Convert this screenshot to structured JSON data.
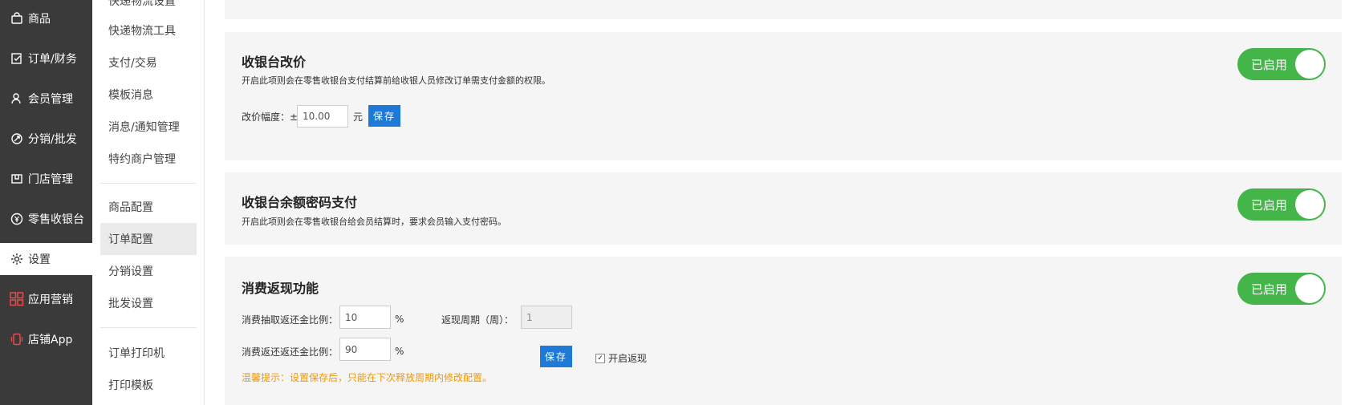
{
  "nav": {
    "items": [
      {
        "label": "商品",
        "icon": "shopping-bag-icon"
      },
      {
        "label": "订单/财务",
        "icon": "order-icon"
      },
      {
        "label": "会员管理",
        "icon": "members-icon"
      },
      {
        "label": "分销/批发",
        "icon": "distribution-icon"
      },
      {
        "label": "门店管理",
        "icon": "store-icon"
      },
      {
        "label": "零售收银台",
        "icon": "cashier-icon"
      },
      {
        "label": "设置",
        "icon": "gear-icon"
      },
      {
        "label": "应用营销",
        "icon": "apps-grid-icon"
      },
      {
        "label": "店铺App",
        "icon": "phone-icon"
      }
    ],
    "active_index": 6
  },
  "subnav": {
    "items": [
      {
        "label": "快递物流设置"
      },
      {
        "label": "快递物流工具"
      },
      {
        "label": "支付/交易"
      },
      {
        "label": "模板消息"
      },
      {
        "label": "消息/通知管理"
      },
      {
        "label": "特约商户管理"
      },
      {
        "label": "商品配置"
      },
      {
        "label": "订单配置"
      },
      {
        "label": "分销设置"
      },
      {
        "label": "批发设置"
      },
      {
        "label": "订单打印机"
      },
      {
        "label": "打印模板"
      }
    ],
    "active_label": "订单配置"
  },
  "panels": {
    "price_change": {
      "title": "收银台改价",
      "desc": "开启此项则会在零售收银台支付结算前给收银人员修改订单需支付金额的权限。",
      "toggle": "已启用",
      "range_label": "改价幅度：±",
      "range_value": "10.00",
      "unit": "元",
      "save": "保存"
    },
    "balance_password": {
      "title": "收银台余额密码支付",
      "desc": "开启此项则会在零售收银台给会员结算时，要求会员输入支付密码。",
      "toggle": "已启用"
    },
    "cashback": {
      "title": "消费返现功能",
      "toggle": "已启用",
      "extract_label": "消费抽取返还金比例：",
      "extract_value": "10",
      "return_label": "消费返还返还金比例：",
      "return_value": "90",
      "percent": "%",
      "period_label": "返现周期（周）：",
      "period_value": "1",
      "save": "保存",
      "enable_label": "开启返现",
      "hint": "温馨提示：设置保存后，只能在下次释放周期内修改配置。"
    }
  },
  "colors": {
    "nav_bg": "#3a3a3a",
    "toggle_on": "#44b549",
    "primary_button": "#1e7ad6",
    "hint": "#f39800"
  }
}
